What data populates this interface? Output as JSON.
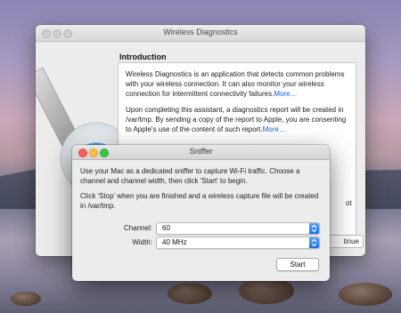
{
  "main_window": {
    "title": "Wireless Diagnostics",
    "section_title": "Introduction",
    "paragraph1": "Wireless Diagnostics is an application that detects common problems with your wireless connection. It can also monitor your wireless connection for intermittent connectivity failures.",
    "paragraph1_link": "More…",
    "paragraph2": "Upon completing this assistant, a diagnostics report will be created in /var/tmp. By sending a copy of the report to Apple, you are consenting to Apple's use of the content of such report.",
    "paragraph2_link": "More…",
    "continue_label": "tinue",
    "partial_text": "ot"
  },
  "dialog": {
    "title": "Sniffer",
    "text1": "Use your Mac as a dedicated sniffer to capture Wi-Fi traffic.  Choose a channel and channel width, then click 'Start' to begin.",
    "text2": "Click 'Stop' when you are finished and a wireless capture file will be created in /var/tmp.",
    "channel_label": "Channel:",
    "channel_value": "60",
    "width_label": "Width:",
    "width_value": "40 MHz",
    "start_label": "Start"
  },
  "colors": {
    "link": "#1a5fd0",
    "accent_popup": "#1b6fe8",
    "close": "#fc605c",
    "minimize": "#fdbc40",
    "maximize": "#34c84a"
  },
  "icons": {
    "illustration": "wireless-diagnostics-wrench-icon",
    "popup_arrows": "updown-chevron-icon"
  }
}
